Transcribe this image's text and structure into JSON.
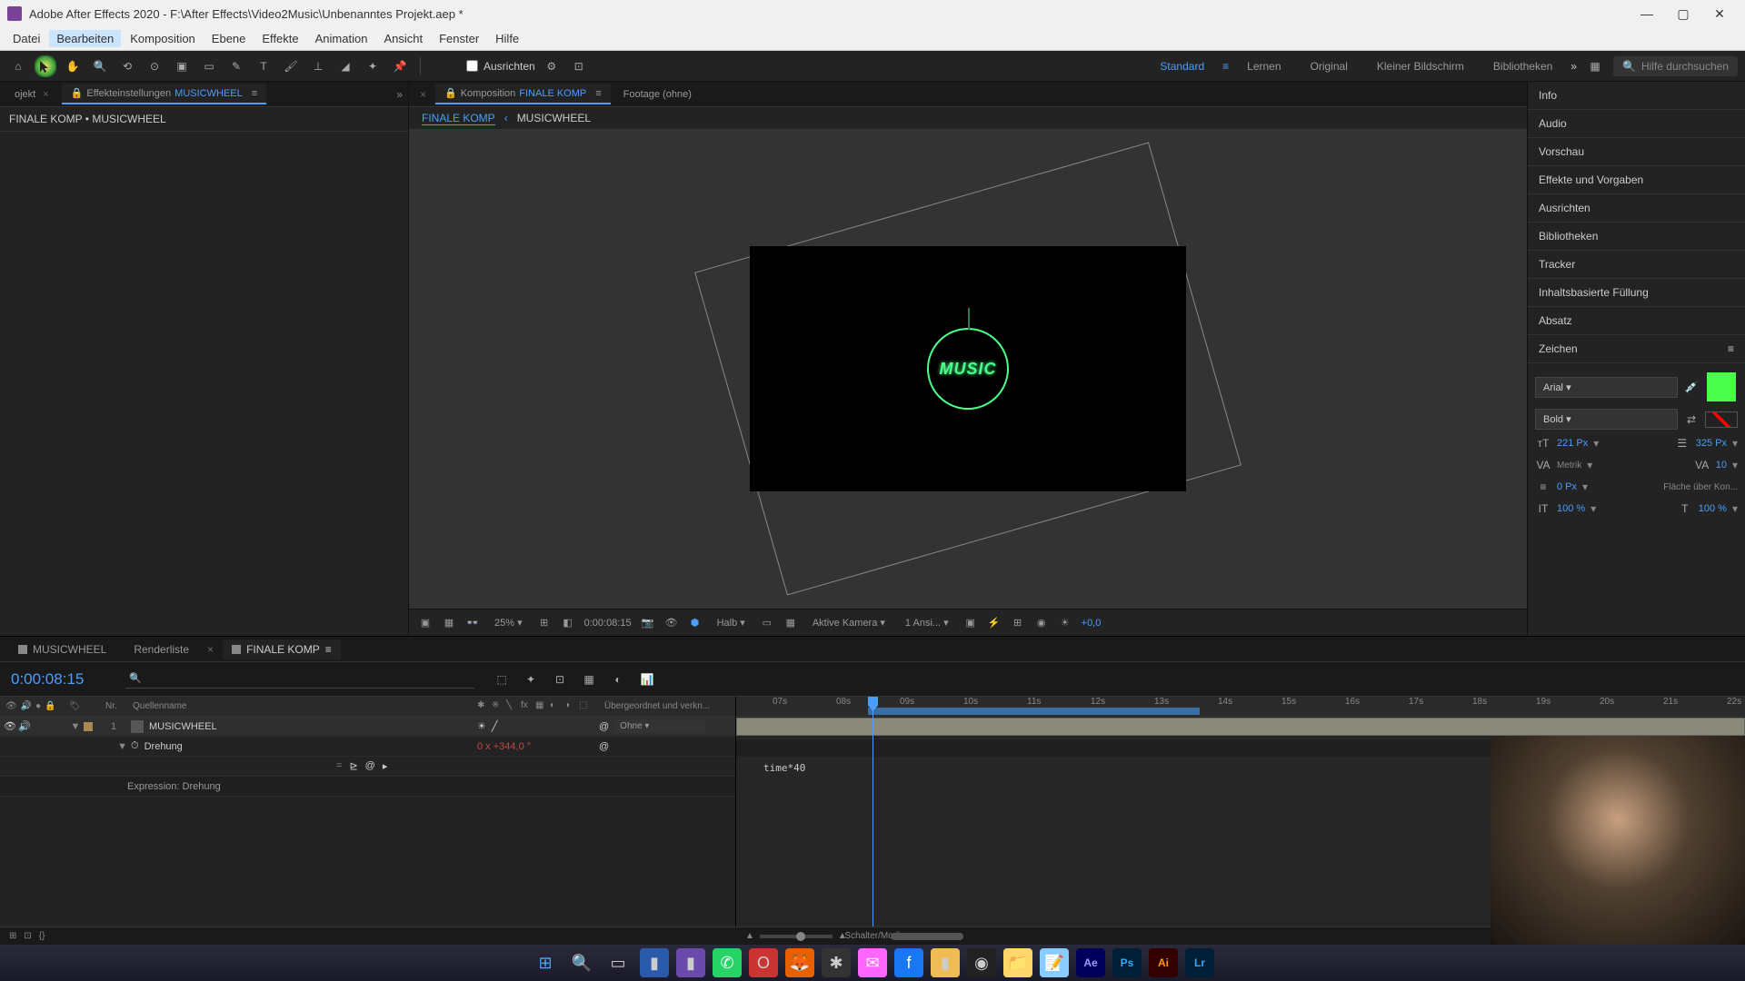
{
  "title_bar": {
    "app_title": "Adobe After Effects 2020 - F:\\After Effects\\Video2Music\\Unbenanntes Projekt.aep *"
  },
  "menus": [
    "Datei",
    "Bearbeiten",
    "Komposition",
    "Ebene",
    "Effekte",
    "Animation",
    "Ansicht",
    "Fenster",
    "Hilfe"
  ],
  "toolbar": {
    "snap_label": "Ausrichten",
    "workspaces": [
      "Standard",
      "Lernen",
      "Original",
      "Kleiner Bildschirm",
      "Bibliotheken"
    ],
    "active_workspace": "Standard",
    "search_placeholder": "Hilfe durchsuchen"
  },
  "left_panel": {
    "tab_project": "ojekt",
    "tab_fx_prefix": "Effekteinstellungen",
    "tab_fx_name": "MUSICWHEEL",
    "breadcrumb": "FINALE KOMP • MUSICWHEEL"
  },
  "comp_panel": {
    "tab_prefix": "Komposition",
    "tab_name": "FINALE KOMP",
    "tab_footage": "Footage (ohne)",
    "bc_1": "FINALE KOMP",
    "bc_2": "MUSICWHEEL",
    "music_text": "MUSIC"
  },
  "comp_footer": {
    "zoom": "25%",
    "timecode": "0:00:08:15",
    "resolution": "Halb",
    "camera": "Aktive Kamera",
    "views": "1 Ansi...",
    "exposure": "+0,0"
  },
  "right_panel": {
    "sections": [
      "Info",
      "Audio",
      "Vorschau",
      "Effekte und Vorgaben",
      "Ausrichten",
      "Bibliotheken",
      "Tracker",
      "Inhaltsbasierte Füllung",
      "Absatz",
      "Zeichen"
    ],
    "char": {
      "font": "Arial",
      "style": "Bold",
      "size": "221 Px",
      "leading": "325 Px",
      "kerning": "Metrik",
      "tracking": "10",
      "stroke_width": "0 Px",
      "stroke_type": "Fläche über Kon...",
      "vscale": "100 %",
      "hscale": "100 %"
    }
  },
  "timeline": {
    "tabs": [
      "MUSICWHEEL",
      "Renderliste",
      "FINALE KOMP"
    ],
    "active_tab": "FINALE KOMP",
    "current_time": "0:00:08:15",
    "cols": {
      "nr": "Nr.",
      "source": "Quellenname",
      "parent": "Übergeordnet und verkn..."
    },
    "layer1": {
      "num": "1",
      "name": "MUSICWHEEL",
      "prop_rotation": "Drehung",
      "rot_prefix": "0 x",
      "rot_value": "+344,0",
      "rot_suffix": "°",
      "expr_label": "Expression: Drehung",
      "parent": "Ohne"
    },
    "expression_text": "time*40",
    "footer_label": "Schalter/Modi",
    "ruler_ticks": [
      "07s",
      "08s",
      "09s",
      "10s",
      "11s",
      "12s",
      "13s",
      "14s",
      "15s",
      "16s",
      "17s",
      "18s",
      "19s",
      "20s",
      "21s",
      "22s"
    ]
  }
}
